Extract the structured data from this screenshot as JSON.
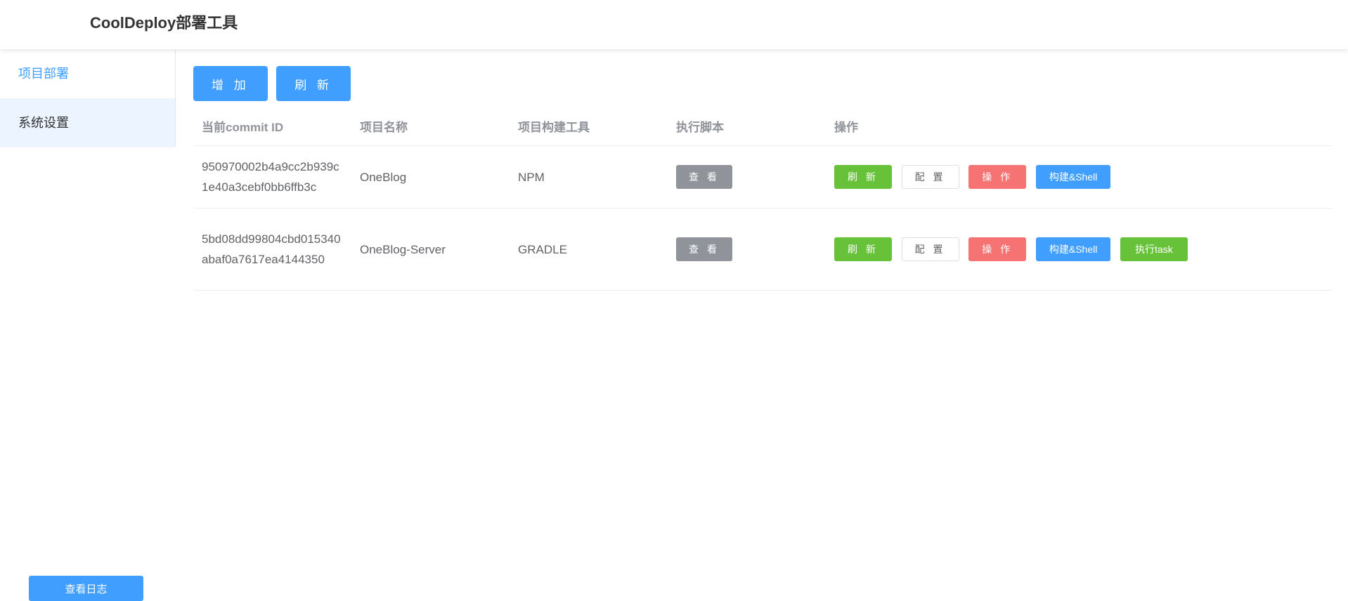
{
  "app": {
    "title": "CoolDeploy部署工具"
  },
  "sidebar": {
    "items": [
      {
        "label": "项目部署"
      },
      {
        "label": "系统设置"
      }
    ],
    "log_button": "查看日志"
  },
  "toolbar": {
    "add_label": "增 加",
    "refresh_label": "刷 新"
  },
  "table": {
    "headers": [
      "当前commit ID",
      "项目名称",
      "项目构建工具",
      "执行脚本",
      "操作"
    ],
    "rows": [
      {
        "commit_id": "950970002b4a9cc2b939c1e40a3cebf0bb6ffb3c",
        "name": "OneBlog",
        "build_tool": "NPM",
        "view_label": "查 看",
        "actions": [
          "刷 新",
          "配 置",
          "操 作",
          "构建&Shell"
        ]
      },
      {
        "commit_id": "5bd08dd99804cbd015340abaf0a7617ea4144350",
        "name": "OneBlog-Server",
        "build_tool": "GRADLE",
        "view_label": "查 看",
        "actions": [
          "刷 新",
          "配 置",
          "操 作",
          "构建&Shell",
          "执行task"
        ]
      }
    ]
  },
  "colors": {
    "primary": "#409eff",
    "success": "#67c23a",
    "danger": "#f56c6c",
    "info": "#909399"
  }
}
